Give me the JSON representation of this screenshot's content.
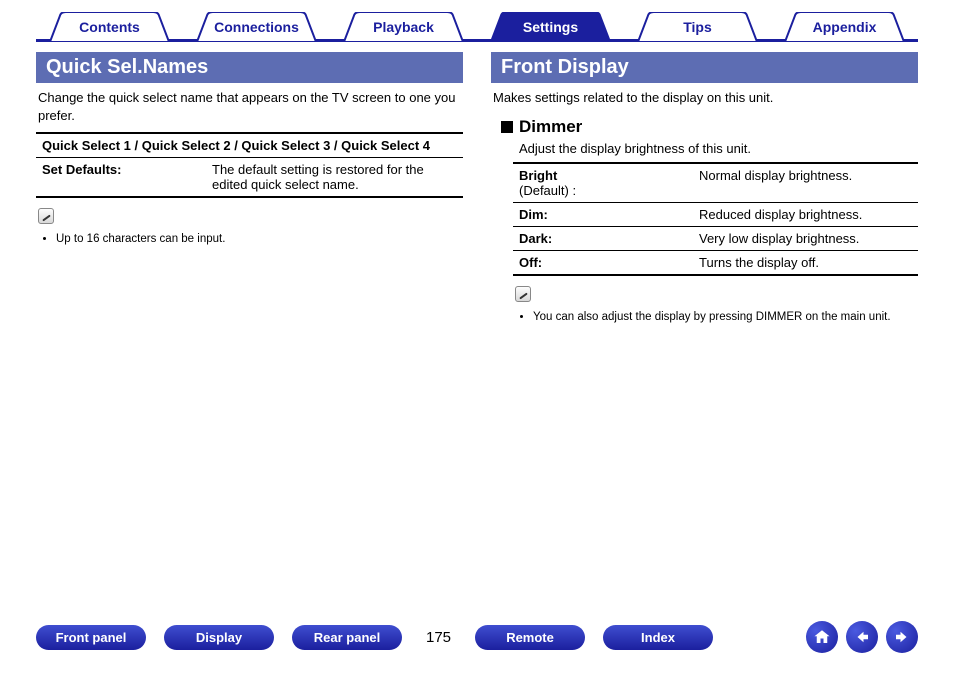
{
  "nav": {
    "tabs": [
      "Contents",
      "Connections",
      "Playback",
      "Settings",
      "Tips",
      "Appendix"
    ],
    "active_index": 3
  },
  "left": {
    "heading": "Quick Sel.Names",
    "intro": "Change the quick select name that appears on the TV screen to one you prefer.",
    "row1": "Quick Select 1 / Quick Select 2 / Quick Select 3 / Quick Select 4",
    "row2_label": "Set Defaults:",
    "row2_desc": "The default setting is restored for the edited quick select name.",
    "note": "Up to 16 characters can be input."
  },
  "right": {
    "heading": "Front Display",
    "intro": "Makes settings related to the display on this unit.",
    "sub_heading": "Dimmer",
    "sub_intro": "Adjust the display brightness of this unit.",
    "rows": [
      {
        "label": "Bright",
        "sublabel": "(Default) :",
        "desc": "Normal display brightness."
      },
      {
        "label": "Dim:",
        "sublabel": "",
        "desc": "Reduced display brightness."
      },
      {
        "label": "Dark:",
        "sublabel": "",
        "desc": "Very low display brightness."
      },
      {
        "label": "Off:",
        "sublabel": "",
        "desc": "Turns the display off."
      }
    ],
    "note": "You can also adjust the display by pressing DIMMER on the main unit."
  },
  "footer": {
    "buttons": [
      "Front panel",
      "Display",
      "Rear panel"
    ],
    "page": "175",
    "buttons2": [
      "Remote",
      "Index"
    ]
  },
  "colors": {
    "brand": "#1b1f9e",
    "section": "#5d6db3"
  }
}
